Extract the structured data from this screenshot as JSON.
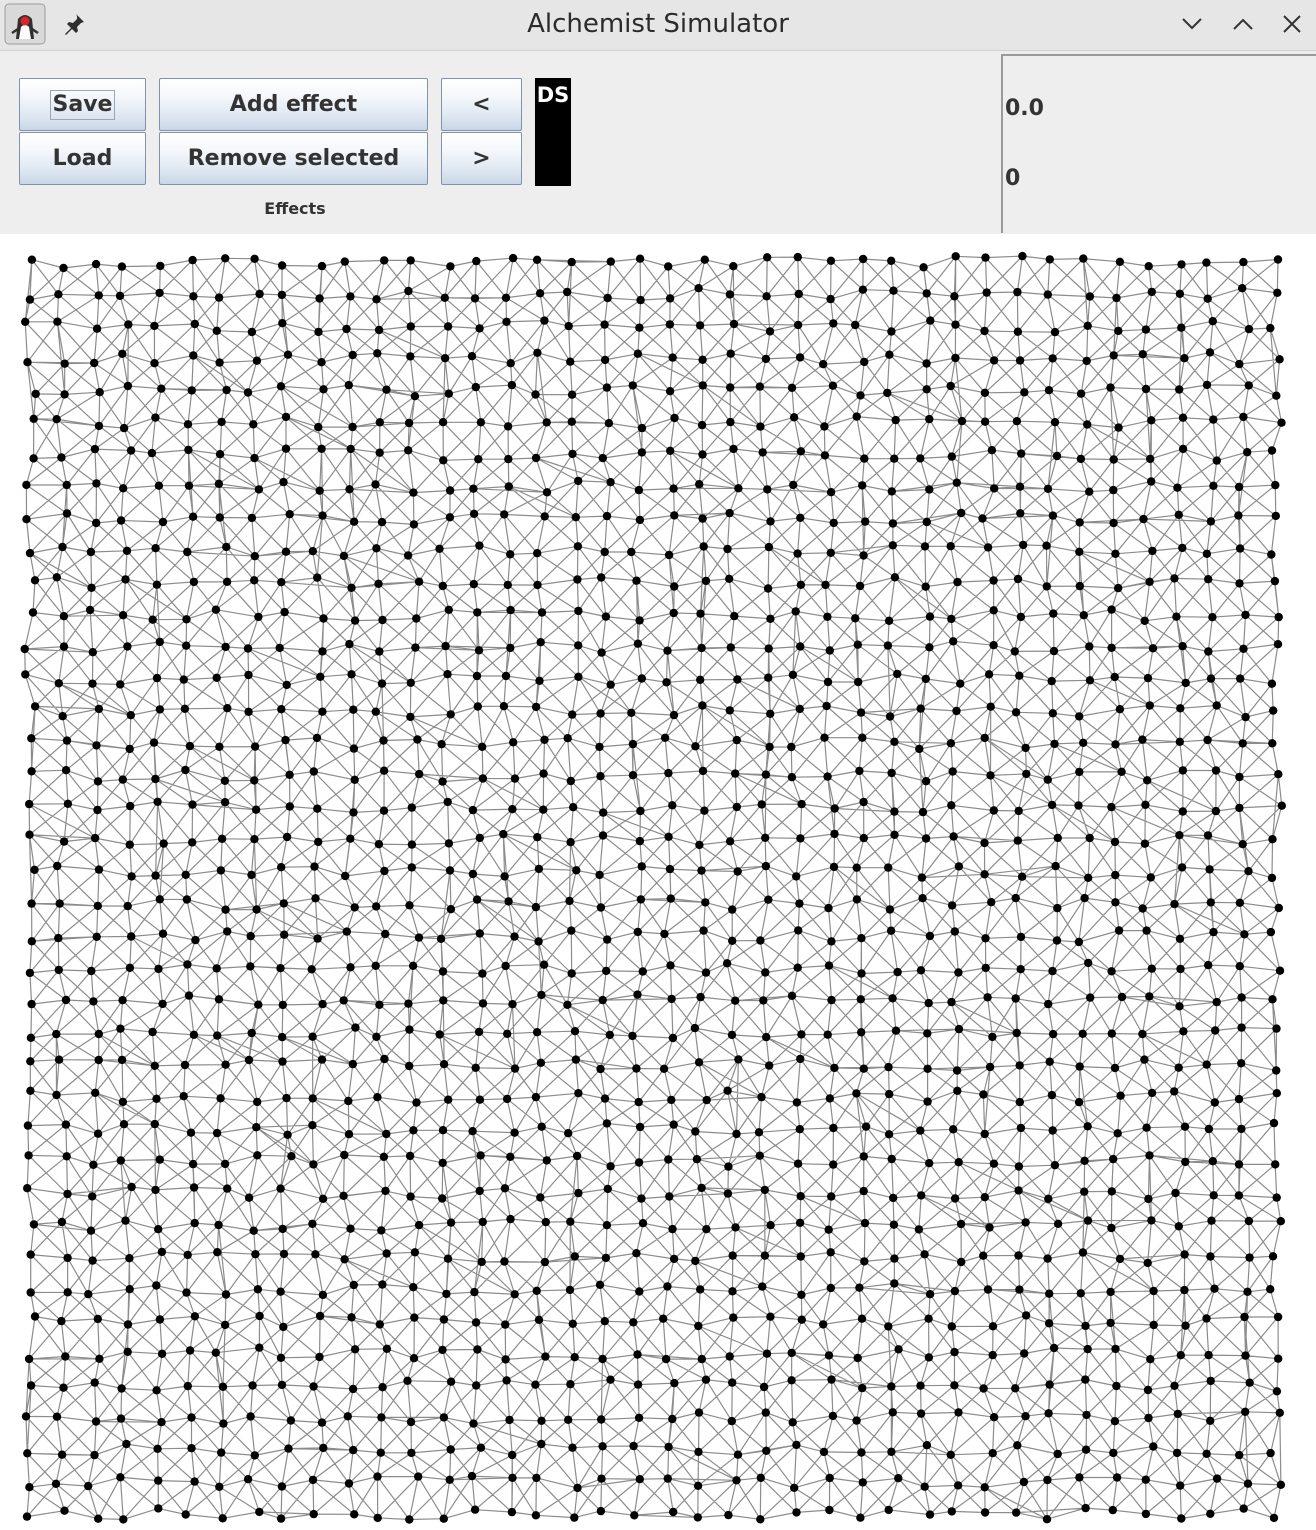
{
  "window": {
    "title": "Alchemist Simulator"
  },
  "titlebar": {
    "app_icon": "java-duke-icon",
    "pin_icon": "pin-icon",
    "minimize_icon": "chevron-down-icon",
    "maximize_icon": "chevron-up-icon",
    "close_icon": "close-icon"
  },
  "toolbar": {
    "save_label": "Save",
    "load_label": "Load",
    "add_effect_label": "Add effect",
    "remove_selected_label": "Remove selected",
    "prev_label": "<",
    "next_label": ">",
    "effects_list_item": "DS",
    "effects_group_label": "Effects"
  },
  "status_panel": {
    "time": "0.0",
    "step": "0"
  },
  "network": {
    "node_color": "#000000",
    "edge_color": "#8c8c8c",
    "background": "#ffffff",
    "layout": "perturbed grid"
  },
  "colors": {
    "titlebar_bg": "#e6e6e6",
    "toolbar_bg": "#eeeeee",
    "ds_box_bg": "#000000",
    "ds_box_fg": "#ffffff"
  }
}
